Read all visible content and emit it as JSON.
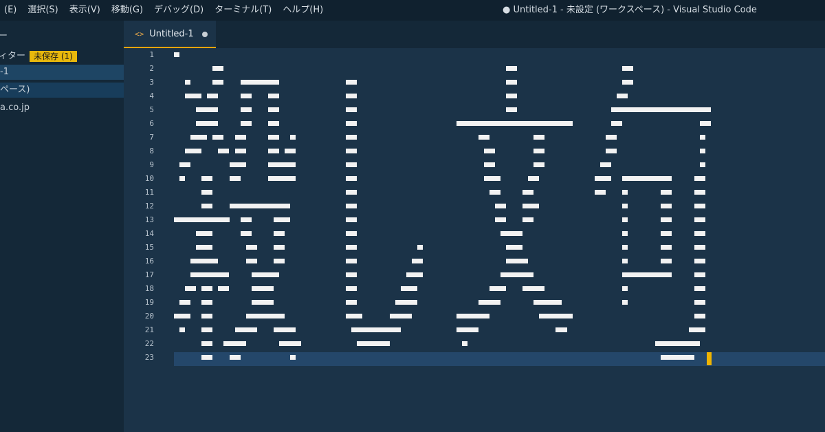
{
  "menubar": {
    "items": [
      "(E)",
      "選択(S)",
      "表示(V)",
      "移動(G)",
      "デバッグ(D)",
      "ターミナル(T)",
      "ヘルプ(H)"
    ]
  },
  "window_title": "● Untitled-1 - 未設定 (ワークスペース) - Visual Studio Code",
  "sidebar": {
    "header": "ー",
    "open_editors_label": "ィター",
    "unsaved_badge": "未保存 (1)",
    "file_item": "-1",
    "workspace_item": "ペース)",
    "domain_item": "a.co.jp"
  },
  "tab": {
    "icon": "<>",
    "label": "Untitled-1"
  },
  "line_numbers": [
    "1",
    "2",
    "3",
    "4",
    "5",
    "6",
    "7",
    "8",
    "9",
    "10",
    "11",
    "12",
    "13",
    "14",
    "15",
    "16",
    "17",
    "18",
    "19",
    "20",
    "21",
    "22",
    "23"
  ],
  "editor": {
    "current_line": 23,
    "art_text": "殺し文句",
    "art_rows": [
      [
        [
          0,
          1
        ]
      ],
      [
        [
          7,
          2
        ],
        [
          60,
          2
        ],
        [
          81,
          2
        ]
      ],
      [
        [
          2,
          1
        ],
        [
          7,
          2
        ],
        [
          12,
          7
        ],
        [
          31,
          2
        ],
        [
          60,
          2
        ],
        [
          81,
          2
        ]
      ],
      [
        [
          2,
          3
        ],
        [
          6,
          2
        ],
        [
          12,
          2
        ],
        [
          17,
          2
        ],
        [
          31,
          2
        ],
        [
          60,
          2
        ],
        [
          80,
          2
        ]
      ],
      [
        [
          4,
          4
        ],
        [
          12,
          2
        ],
        [
          17,
          2
        ],
        [
          31,
          2
        ],
        [
          60,
          2
        ],
        [
          79,
          18
        ]
      ],
      [
        [
          4,
          4
        ],
        [
          12,
          2
        ],
        [
          17,
          2
        ],
        [
          31,
          2
        ],
        [
          51,
          21
        ],
        [
          79,
          2
        ],
        [
          95,
          2
        ]
      ],
      [
        [
          3,
          3
        ],
        [
          7,
          2
        ],
        [
          11,
          2
        ],
        [
          17,
          2
        ],
        [
          21,
          1
        ],
        [
          31,
          2
        ],
        [
          55,
          2
        ],
        [
          65,
          2
        ],
        [
          78,
          2
        ],
        [
          95,
          1
        ]
      ],
      [
        [
          2,
          3
        ],
        [
          8,
          2
        ],
        [
          11,
          2
        ],
        [
          17,
          2
        ],
        [
          20,
          2
        ],
        [
          31,
          2
        ],
        [
          56,
          2
        ],
        [
          65,
          2
        ],
        [
          78,
          2
        ],
        [
          95,
          1
        ]
      ],
      [
        [
          1,
          2
        ],
        [
          10,
          3
        ],
        [
          17,
          5
        ],
        [
          31,
          2
        ],
        [
          56,
          2
        ],
        [
          65,
          2
        ],
        [
          77,
          2
        ],
        [
          95,
          1
        ]
      ],
      [
        [
          1,
          1
        ],
        [
          5,
          2
        ],
        [
          10,
          2
        ],
        [
          17,
          5
        ],
        [
          31,
          2
        ],
        [
          56,
          3
        ],
        [
          64,
          2
        ],
        [
          76,
          3
        ],
        [
          81,
          9
        ],
        [
          94,
          2
        ]
      ],
      [
        [
          5,
          2
        ],
        [
          31,
          2
        ],
        [
          57,
          2
        ],
        [
          63,
          2
        ],
        [
          76,
          2
        ],
        [
          81,
          1
        ],
        [
          88,
          2
        ],
        [
          94,
          2
        ]
      ],
      [
        [
          5,
          2
        ],
        [
          10,
          11
        ],
        [
          31,
          2
        ],
        [
          58,
          2
        ],
        [
          63,
          3
        ],
        [
          81,
          1
        ],
        [
          88,
          2
        ],
        [
          94,
          2
        ]
      ],
      [
        [
          0,
          10
        ],
        [
          12,
          2
        ],
        [
          18,
          3
        ],
        [
          31,
          2
        ],
        [
          58,
          2
        ],
        [
          63,
          2
        ],
        [
          81,
          1
        ],
        [
          88,
          2
        ],
        [
          94,
          2
        ]
      ],
      [
        [
          4,
          3
        ],
        [
          12,
          2
        ],
        [
          18,
          2
        ],
        [
          31,
          2
        ],
        [
          59,
          4
        ],
        [
          81,
          1
        ],
        [
          88,
          2
        ],
        [
          94,
          2
        ]
      ],
      [
        [
          4,
          3
        ],
        [
          13,
          2
        ],
        [
          18,
          2
        ],
        [
          31,
          2
        ],
        [
          44,
          1
        ],
        [
          60,
          3
        ],
        [
          81,
          1
        ],
        [
          88,
          2
        ],
        [
          94,
          2
        ]
      ],
      [
        [
          3,
          5
        ],
        [
          13,
          2
        ],
        [
          18,
          2
        ],
        [
          31,
          2
        ],
        [
          43,
          2
        ],
        [
          60,
          4
        ],
        [
          81,
          1
        ],
        [
          88,
          2
        ],
        [
          94,
          2
        ]
      ],
      [
        [
          3,
          7
        ],
        [
          14,
          5
        ],
        [
          31,
          2
        ],
        [
          42,
          3
        ],
        [
          59,
          6
        ],
        [
          81,
          9
        ],
        [
          94,
          2
        ]
      ],
      [
        [
          2,
          2
        ],
        [
          5,
          2
        ],
        [
          8,
          2
        ],
        [
          14,
          4
        ],
        [
          31,
          2
        ],
        [
          41,
          3
        ],
        [
          57,
          3
        ],
        [
          63,
          4
        ],
        [
          81,
          1
        ],
        [
          94,
          2
        ]
      ],
      [
        [
          1,
          2
        ],
        [
          5,
          2
        ],
        [
          14,
          4
        ],
        [
          31,
          2
        ],
        [
          40,
          4
        ],
        [
          55,
          4
        ],
        [
          65,
          5
        ],
        [
          81,
          1
        ],
        [
          94,
          2
        ]
      ],
      [
        [
          0,
          3
        ],
        [
          5,
          2
        ],
        [
          13,
          7
        ],
        [
          31,
          3
        ],
        [
          39,
          4
        ],
        [
          51,
          6
        ],
        [
          66,
          6
        ],
        [
          94,
          2
        ]
      ],
      [
        [
          1,
          1
        ],
        [
          5,
          2
        ],
        [
          11,
          4
        ],
        [
          18,
          4
        ],
        [
          32,
          9
        ],
        [
          51,
          4
        ],
        [
          69,
          2
        ],
        [
          93,
          3
        ]
      ],
      [
        [
          5,
          2
        ],
        [
          9,
          4
        ],
        [
          19,
          4
        ],
        [
          33,
          6
        ],
        [
          52,
          1
        ],
        [
          87,
          8
        ]
      ],
      [
        [
          5,
          2
        ],
        [
          10,
          2
        ],
        [
          21,
          1
        ],
        [
          88,
          6
        ]
      ]
    ]
  }
}
